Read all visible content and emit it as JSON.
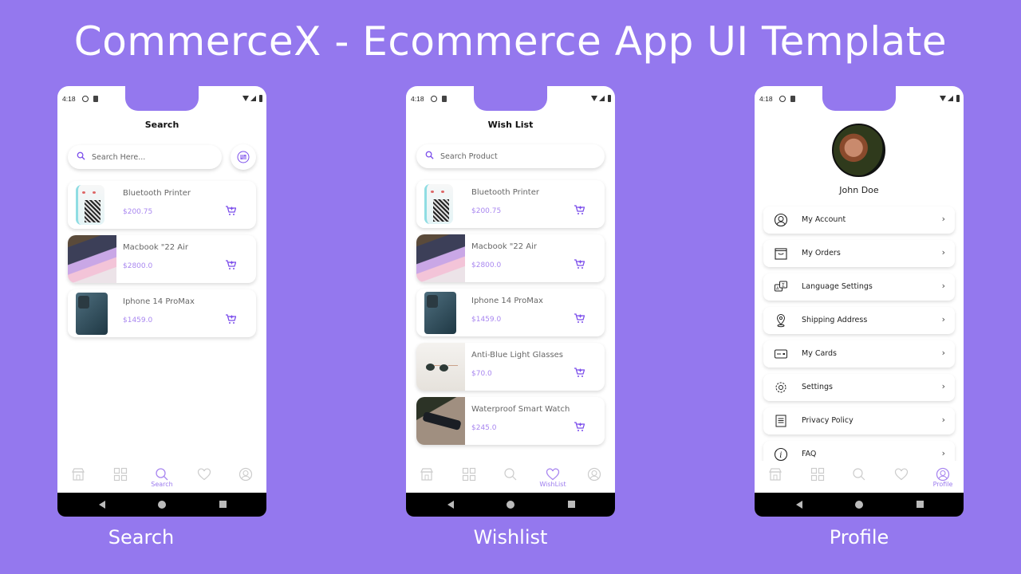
{
  "headline": "CommerceX - Ecommerce App UI Template",
  "colors": {
    "background": "#9478EE",
    "accent": "#7B4DEB",
    "price": "#A987F0",
    "inactive_icon": "#C8C8C8"
  },
  "status_bar": {
    "time": "4:18"
  },
  "captions": {
    "search": "Search",
    "wishlist": "Wishlist",
    "profile": "Profile"
  },
  "search_screen": {
    "title": "Search",
    "search_placeholder": "Search Here...",
    "filter_icon": "filter-sliders-icon",
    "products": [
      {
        "name": "Bluetooth Printer",
        "price": "$200.75",
        "thumb": "printer"
      },
      {
        "name": "Macbook \"22 Air",
        "price": "$2800.0",
        "thumb": "laptop"
      },
      {
        "name": "Iphone 14 ProMax",
        "price": "$1459.0",
        "thumb": "phone"
      }
    ],
    "active_tab": "Search"
  },
  "wishlist_screen": {
    "title": "Wish List",
    "search_placeholder": "Search Product",
    "products": [
      {
        "name": "Bluetooth Printer",
        "price": "$200.75",
        "thumb": "printer"
      },
      {
        "name": "Macbook \"22 Air",
        "price": "$2800.0",
        "thumb": "laptop"
      },
      {
        "name": "Iphone 14 ProMax",
        "price": "$1459.0",
        "thumb": "phone"
      },
      {
        "name": "Anti-Blue Light Glasses",
        "price": "$70.0",
        "thumb": "glasses"
      },
      {
        "name": "Waterproof Smart Watch",
        "price": "$245.0",
        "thumb": "watch"
      }
    ],
    "active_tab": "WishList"
  },
  "profile_screen": {
    "user_name": "John Doe",
    "menu": [
      {
        "label": "My Account",
        "icon": "user-circle-icon"
      },
      {
        "label": "My Orders",
        "icon": "shopping-bag-icon"
      },
      {
        "label": "Language Settings",
        "icon": "translate-icon"
      },
      {
        "label": "Shipping Address",
        "icon": "location-pin-icon"
      },
      {
        "label": "My Cards",
        "icon": "credit-card-icon"
      },
      {
        "label": "Settings",
        "icon": "gear-icon"
      },
      {
        "label": "Privacy Policy",
        "icon": "document-icon"
      },
      {
        "label": "FAQ",
        "icon": "info-icon"
      }
    ],
    "active_tab": "Profile"
  },
  "bottom_nav": [
    "store",
    "categories",
    "search",
    "wishlist",
    "profile"
  ]
}
